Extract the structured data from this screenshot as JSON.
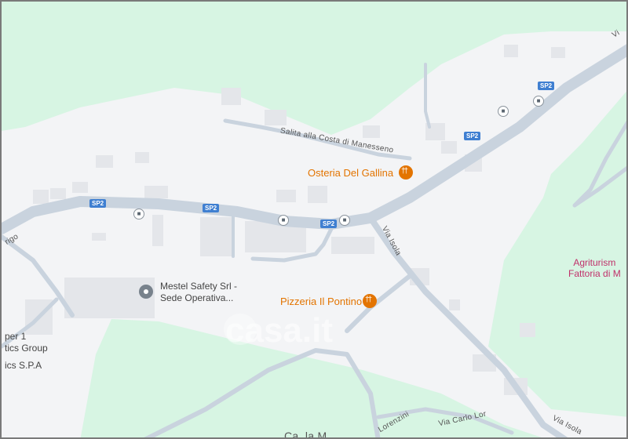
{
  "map": {
    "colors": {
      "background": "#f3f4f6",
      "park": "#d7f5e3",
      "road": "#c4cfda",
      "road_edge": "#b3bfcc",
      "building": "#e7e9ec",
      "accent_food": "#e37400"
    },
    "places": {
      "osteria": {
        "name": "Osteria Del Gallina",
        "icon": "restaurant-icon"
      },
      "pizzeria": {
        "name": "Pizzeria Il Pontino",
        "icon": "restaurant-icon"
      },
      "mestel": {
        "line1": "Mestel Safety Srl -",
        "line2": "Sede Operativa...",
        "icon": "place-pin-icon"
      },
      "agriturismo": {
        "line1": "Agriturism",
        "line2": "Fattoria di M"
      },
      "logistics": {
        "line1": "per 1",
        "line2": "tics Group"
      },
      "spa": {
        "name": "ics S.P.A"
      }
    },
    "roads": {
      "salita": "Salita alla Costa di Manesseno",
      "via_isola": "Via Isola",
      "via_isola_2": "Via Isola",
      "via_carlo": "Via Carlo Lor",
      "lorenzini": "Lorenzini",
      "vigo": "rigo",
      "vi": "Vi",
      "sp2": "SP2",
      "bottom_cut": "Ca..la M..."
    },
    "watermark": "casa.it"
  }
}
